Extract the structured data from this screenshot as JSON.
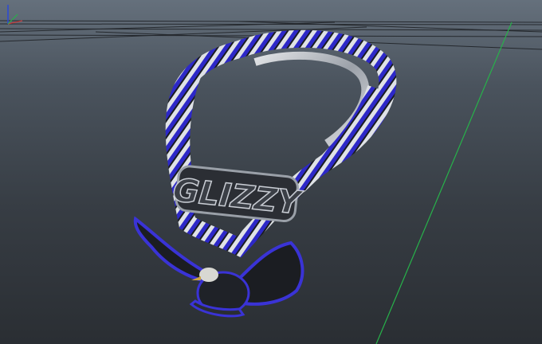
{
  "viewport": {
    "background_top": "#65707c",
    "background_bottom": "#2a2e33",
    "grid_line_color": "#1c1f23",
    "axis_z_color": "#27b24a",
    "axis_y_color": "#2b49d8",
    "axis_x_color": "#c23a3a"
  },
  "model": {
    "pendant_text": "GLIZZY",
    "chain_metal_color": "#c9cdd4",
    "chain_gem_color": "#2d28c8",
    "eagle_color": "#1b1d22",
    "eagle_outline_color": "#3a33d6"
  }
}
